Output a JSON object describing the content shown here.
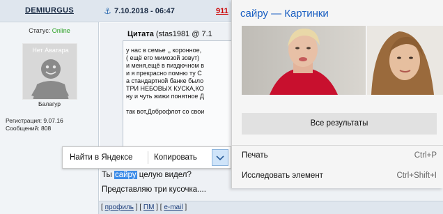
{
  "user": {
    "username": "DEMIURGUS",
    "status_label": "Статус:",
    "status_value": "Online",
    "avatar_caption": "Нет Аватара",
    "title": "Балагур",
    "registration": "Регистрация: 9.07.16",
    "messages": "Сообщений: 808"
  },
  "post": {
    "date": "7.10.2018 - 06:47",
    "number": "911",
    "quote_title_bold": "Цитата",
    "quote_title_rest": " (stas1981 @ 7.1",
    "quote_lines": [
      "у нас в семье ,, коронное,",
      "( ещё его мимозой зовут)",
      "и меня,ещё в пиздючном в",
      "и я прекрасно помню ту С",
      "а стандартной банке было",
      "ТРИ НЕБОВЫХ КУСКА,КО",
      "ну и чуть жижи понятное Д",
      "",
      "так вот,Доброфлот со свои"
    ],
    "text_before": "Ты ",
    "text_selected": "сайру",
    "text_after": " целую видел?",
    "text_line2": "Представляю три кусочка...."
  },
  "footer": {
    "open1": "[ ",
    "profile": "профиль",
    "sep1": " ] [ ",
    "pm": "ПМ",
    "sep2": " ] [ ",
    "email": "e-mail",
    "close": " ]"
  },
  "toolbar": {
    "find_yandex": "Найти в Яндексе",
    "copy": "Копировать",
    "more_icon": "chevron-down-icon"
  },
  "popup": {
    "title": "сайру — Картинки",
    "all_results": "Все результаты",
    "menu": [
      {
        "label": "Печать",
        "shortcut": "Ctrl+P"
      },
      {
        "label": "Исследовать элемент",
        "shortcut": "Ctrl+Shift+I"
      }
    ]
  },
  "colors": {
    "selection": "#3d8ce8",
    "status_online": "#27a020",
    "post_number": "#cc0000",
    "popup_title": "#1a5fc2"
  }
}
